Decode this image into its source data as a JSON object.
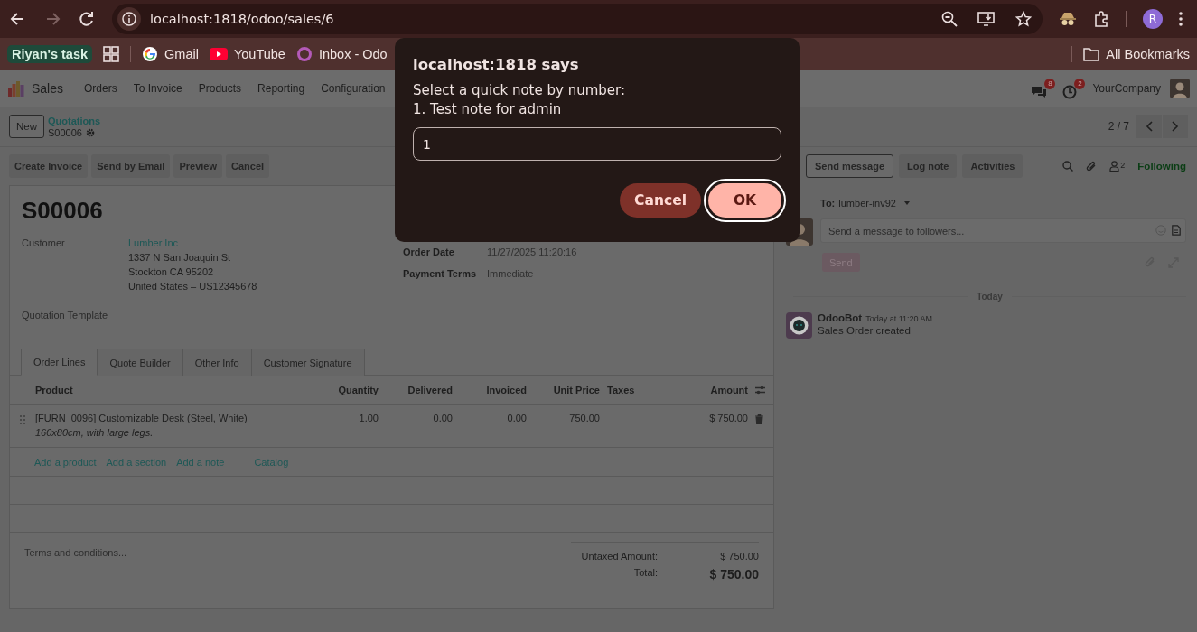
{
  "browser": {
    "nav": [
      {
        "kind": "back",
        "disabled": false
      },
      {
        "kind": "forward",
        "disabled": true
      },
      {
        "kind": "reload",
        "disabled": false
      }
    ],
    "url": "localhost:1818/odoo/sales/6",
    "profile_initial": "R",
    "bookmarks": [
      {
        "kind": "group",
        "label": "Riyan's task"
      },
      {
        "kind": "apps"
      },
      {
        "kind": "google",
        "label": "Gmail"
      },
      {
        "kind": "youtube",
        "label": "YouTube"
      },
      {
        "kind": "inbox",
        "label": "Inbox - Odo"
      }
    ],
    "all_bookmarks": "All Bookmarks"
  },
  "app": {
    "name": "Sales",
    "menus": [
      "Orders",
      "To Invoice",
      "Products",
      "Reporting",
      "Configuration"
    ],
    "systray": [
      {
        "kind": "messages",
        "badge": "8"
      },
      {
        "kind": "activities",
        "badge": "2"
      }
    ],
    "company": "YourCompany"
  },
  "control_panel": {
    "new_button": "New",
    "breadcrumb": "Quotations",
    "record": "S00006",
    "pager": "2 / 7"
  },
  "actions": [
    "Create Invoice",
    "Send by Email",
    "Preview",
    "Cancel"
  ],
  "form": {
    "title": "S00006",
    "customer": {
      "label": "Customer",
      "name": "Lumber Inc",
      "address": [
        "1337 N San Joaquin St",
        "Stockton CA 95202",
        "United States – US12345678"
      ]
    },
    "quotation_template": {
      "label": "Quotation Template"
    },
    "order_date": {
      "label": "Order Date",
      "value": "11/27/2025 11:20:16"
    },
    "payment_terms": {
      "label": "Payment Terms",
      "value": "Immediate"
    },
    "tabs": [
      {
        "label": "Order Lines",
        "selected": true
      },
      {
        "label": "Quote Builder",
        "selected": false
      },
      {
        "label": "Other Info",
        "selected": false
      },
      {
        "label": "Customer Signature",
        "selected": false
      }
    ],
    "table": {
      "columns": [
        "Product",
        "Quantity",
        "Delivered",
        "Invoiced",
        "Unit Price",
        "Taxes",
        "Amount"
      ],
      "rows": [
        {
          "product": "[FURN_0096] Customizable Desk (Steel, White)",
          "description": "160x80cm, with large legs.",
          "quantity": "1.00",
          "delivered": "0.00",
          "invoiced": "0.00",
          "unit_price": "750.00",
          "amount": "$ 750.00"
        }
      ],
      "add_links": [
        "Add a product",
        "Add a section",
        "Add a note",
        "Catalog"
      ]
    },
    "terms_placeholder": "Terms and conditions...",
    "totals": [
      {
        "kind": "subtotal",
        "label": "Untaxed Amount:",
        "value": "$ 750.00"
      },
      {
        "kind": "total",
        "label": "Total:",
        "value": "$ 750.00"
      }
    ]
  },
  "chatter": {
    "buttons": [
      {
        "label": "Send message",
        "selected": true
      },
      {
        "label": "Log note",
        "selected": false
      },
      {
        "label": "Activities",
        "selected": false
      }
    ],
    "followers": "2",
    "follow_label": "Following",
    "to_label": "To:",
    "recipient": "lumber-inv92",
    "composer_placeholder": "Send a message to followers...",
    "send": {
      "label": "Send",
      "disabled": true
    },
    "date_separator": "Today",
    "messages": [
      {
        "author": "OdooBot",
        "time": "Today at 11:20 AM",
        "body": "Sales Order created"
      }
    ]
  },
  "dialog": {
    "title": "localhost:1818 says",
    "message": [
      "Select a quick note by number:",
      "1. Test note for admin"
    ],
    "value": "1",
    "buttons": [
      {
        "kind": "secondary",
        "label": "Cancel",
        "focused": false
      },
      {
        "kind": "primary",
        "label": "OK",
        "focused": true
      }
    ]
  }
}
